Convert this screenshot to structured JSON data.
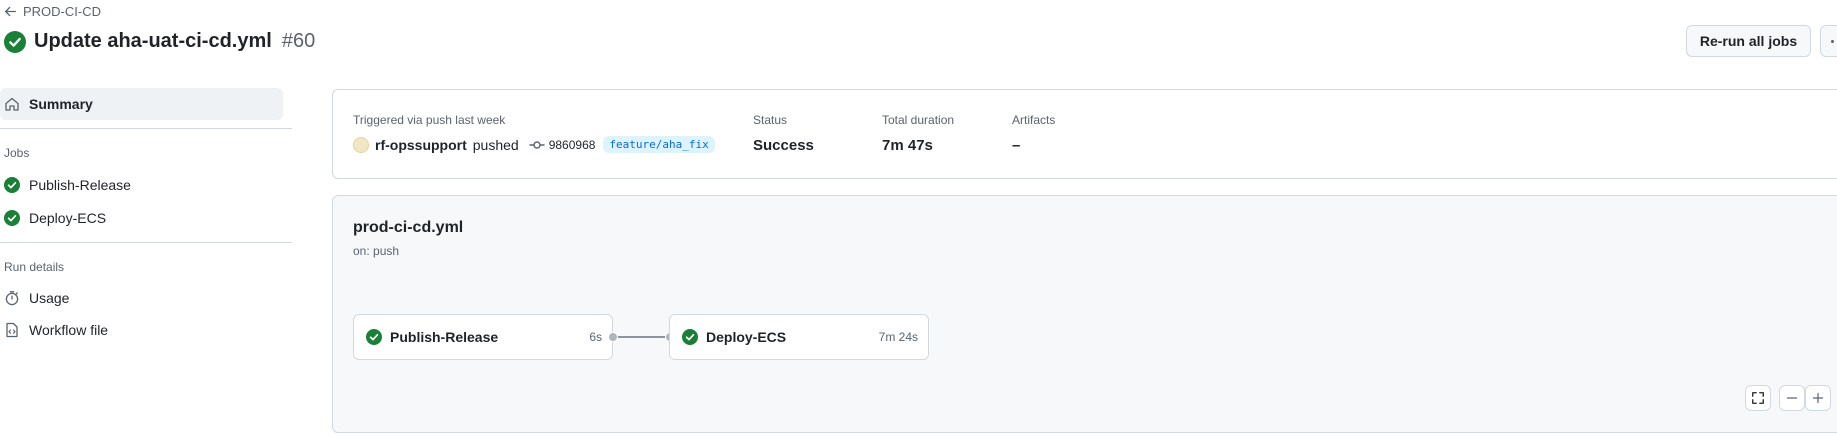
{
  "nav": {
    "back_label": "PROD-CI-CD"
  },
  "header": {
    "title": "Update aha-uat-ci-cd.yml",
    "run_number": "#60",
    "rerun_label": "Re-run all jobs"
  },
  "sidebar": {
    "summary_label": "Summary",
    "jobs_heading": "Jobs",
    "jobs": [
      {
        "label": "Publish-Release",
        "status": "success"
      },
      {
        "label": "Deploy-ECS",
        "status": "success"
      }
    ],
    "run_details_heading": "Run details",
    "run_details": [
      {
        "label": "Usage",
        "icon": "stopwatch-icon"
      },
      {
        "label": "Workflow file",
        "icon": "file-code-icon"
      }
    ]
  },
  "summary": {
    "trigger_label": "Triggered via push last week",
    "user": "rf-opssupport",
    "action": "pushed",
    "commit": "9860968",
    "branch": "feature/aha_fix",
    "status_label": "Status",
    "status_value": "Success",
    "duration_label": "Total duration",
    "duration_value": "7m 47s",
    "artifacts_label": "Artifacts",
    "artifacts_value": "–"
  },
  "workflow": {
    "name": "prod-ci-cd.yml",
    "trigger": "on: push",
    "jobs": [
      {
        "name": "Publish-Release",
        "duration": "6s"
      },
      {
        "name": "Deploy-ECS",
        "duration": "7m 24s"
      }
    ]
  },
  "colors": {
    "success": "#1a7f37",
    "accent": "#0969da",
    "border": "#d1d9e0",
    "muted": "#59636e"
  }
}
